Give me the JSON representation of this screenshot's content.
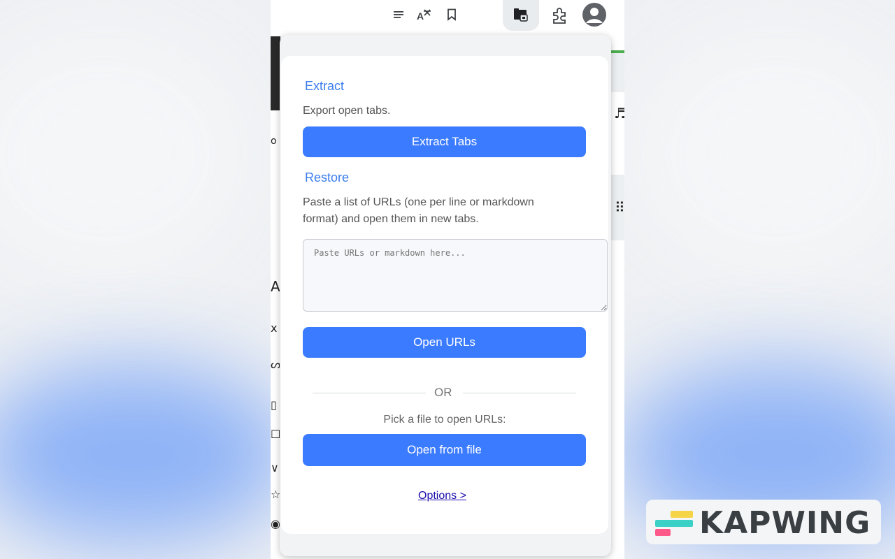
{
  "popup": {
    "extract": {
      "title": "Extract",
      "description": "Export open tabs.",
      "button": "Extract Tabs"
    },
    "restore": {
      "title": "Restore",
      "description_line1": "Paste a list of URLs (one per line or markdown",
      "description_line2": "format) and open them in new tabs.",
      "textarea_placeholder": "Paste URLs or markdown here...",
      "button": "Open URLs"
    },
    "divider": "OR",
    "file": {
      "label": "Pick a file to open URLs:",
      "button": "Open from file"
    },
    "options_link": "Options >"
  },
  "toolbar": {
    "icons": [
      "reading-list-icon",
      "translate-icon",
      "bookmark-icon",
      "tab-extractor-extension-icon",
      "extensions-puzzle-icon",
      "profile-avatar-icon"
    ]
  },
  "colors": {
    "accent": "#3b7bff",
    "title": "#3b7ded",
    "link": "#1a0dab"
  },
  "watermark": {
    "text": "KAPWING"
  }
}
